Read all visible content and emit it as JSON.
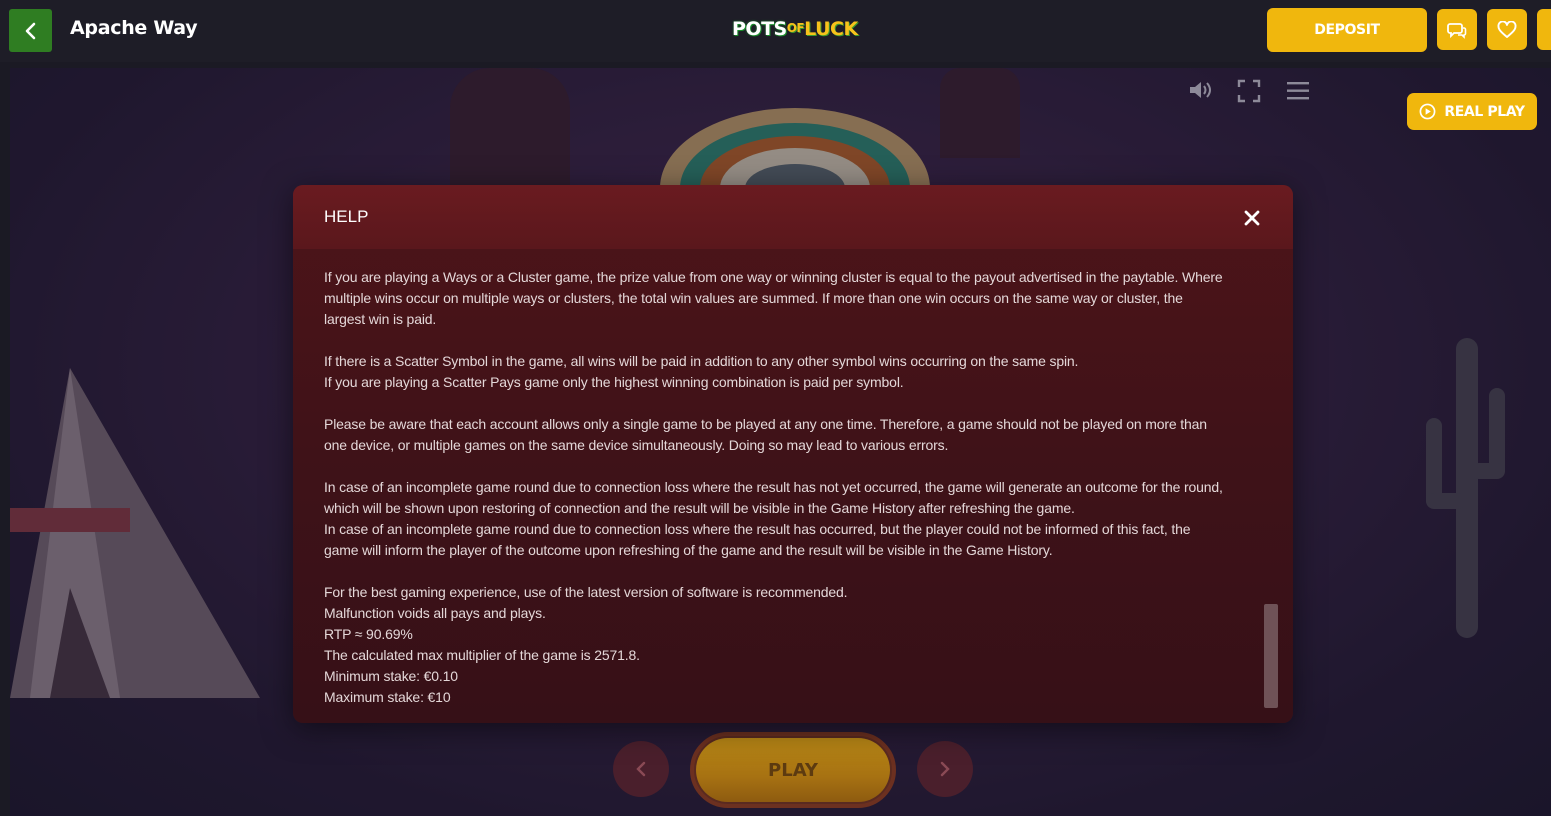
{
  "header": {
    "back_label": "Back",
    "game_title": "Apache Way",
    "logo": {
      "part1": "POTS",
      "part2": "OF",
      "part3": "LUCK"
    },
    "deposit_label": "DEPOSIT"
  },
  "game": {
    "real_play_label": "REAL PLAY",
    "play_label": "PLAY"
  },
  "help": {
    "title": "HELP",
    "paragraphs": [
      {
        "lines": [
          "If you are playing a Ways or a Cluster game, the prize value from one way or winning cluster is equal to the payout advertised in the paytable. Where",
          "multiple wins occur on multiple ways or clusters, the total win values are summed. If more than one win occurs on the same way or cluster, the",
          "largest win is paid."
        ]
      },
      {
        "lines": [
          "If there is a Scatter Symbol in the game, all wins will be paid in addition to any other symbol wins occurring on the same spin.",
          "If you are playing a Scatter Pays game only the highest winning combination is paid per symbol."
        ]
      },
      {
        "lines": [
          "Please be aware that each account allows only a single game to be played at any one time. Therefore, a game should not be played on more than",
          "one device, or multiple games on the same device simultaneously. Doing so may lead to various errors."
        ]
      },
      {
        "lines": [
          "In case of an incomplete game round due to connection loss where the result has not yet occurred, the game will generate an outcome for the round,",
          "which will be shown upon restoring of connection and the result will be visible in the Game History after refreshing the game.",
          "In case of an incomplete game round due to connection loss where the result has occurred, but the player could not be informed of this fact, the",
          "game will inform the player of the outcome upon refreshing of the game and the result will be visible in the Game History."
        ]
      },
      {
        "lines": [
          "For the best gaming experience, use of the latest version of software is recommended.",
          "Malfunction voids all pays and plays.",
          "RTP ≈ 90.69%",
          "The calculated max multiplier of the game is 2571.8.",
          "Minimum stake: €0.10",
          "Maximum stake: €10"
        ]
      }
    ]
  },
  "colors": {
    "accent_yellow": "#f0b70d",
    "back_green": "#2f7d22",
    "modal_bg": "#3f1218",
    "header_bg": "#1e1d27"
  },
  "icons": {
    "back": "chevron-left-icon",
    "chat": "chat-icon",
    "favorite": "heart-icon",
    "sound": "speaker-icon",
    "fullscreen": "fullscreen-icon",
    "menu": "hamburger-menu-icon",
    "play_circle": "play-circle-icon",
    "close": "close-icon",
    "prev": "chevron-left-icon",
    "next": "chevron-right-icon"
  }
}
